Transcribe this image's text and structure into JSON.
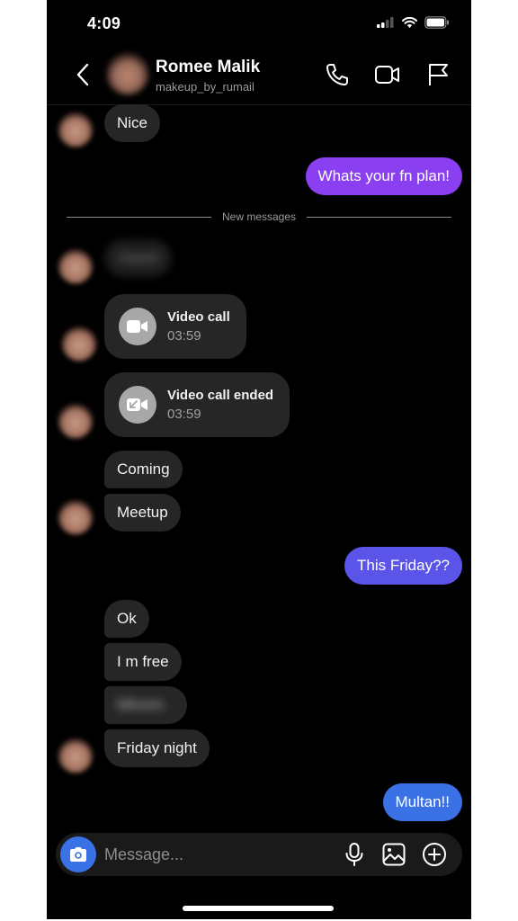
{
  "status_bar": {
    "time": "4:09"
  },
  "header": {
    "name": "Romee Malik",
    "username": "makeup_by_rumail",
    "icons": [
      "back-chevron-icon",
      "phone-icon",
      "video-camera-icon",
      "flag-icon"
    ]
  },
  "colors": {
    "background": "#000000",
    "incoming_bubble": "#262626",
    "outgoing_purple": "#8a3ff0",
    "outgoing_indigo": "#5a55e8",
    "outgoing_blue": "#3a72e6",
    "call_icon_bg": "#a8a8a8"
  },
  "divider": {
    "label": "New messages"
  },
  "messages": [
    {
      "side": "in",
      "text": "Nice"
    },
    {
      "side": "out",
      "text": "Whats your fn plan!"
    },
    {
      "side": "in",
      "text": "Sweet",
      "blurred": true
    },
    {
      "side": "in",
      "type": "call",
      "title": "Video call",
      "duration": "03:59"
    },
    {
      "side": "in",
      "type": "call",
      "title": "Video call ended",
      "duration": "03:59"
    },
    {
      "side": "in",
      "text": "Coming"
    },
    {
      "side": "in",
      "text": "Meetup"
    },
    {
      "side": "out",
      "text": "This Friday??"
    },
    {
      "side": "in",
      "text": "Ok"
    },
    {
      "side": "in",
      "text": "I m free"
    },
    {
      "side": "in",
      "text": "Mhmm",
      "blurred": true
    },
    {
      "side": "in",
      "text": "Friday night"
    },
    {
      "side": "out",
      "text": "Multan!!"
    }
  ],
  "composer": {
    "placeholder": "Message...",
    "icons": [
      "camera-icon",
      "microphone-icon",
      "gallery-icon",
      "plus-circle-icon"
    ]
  }
}
